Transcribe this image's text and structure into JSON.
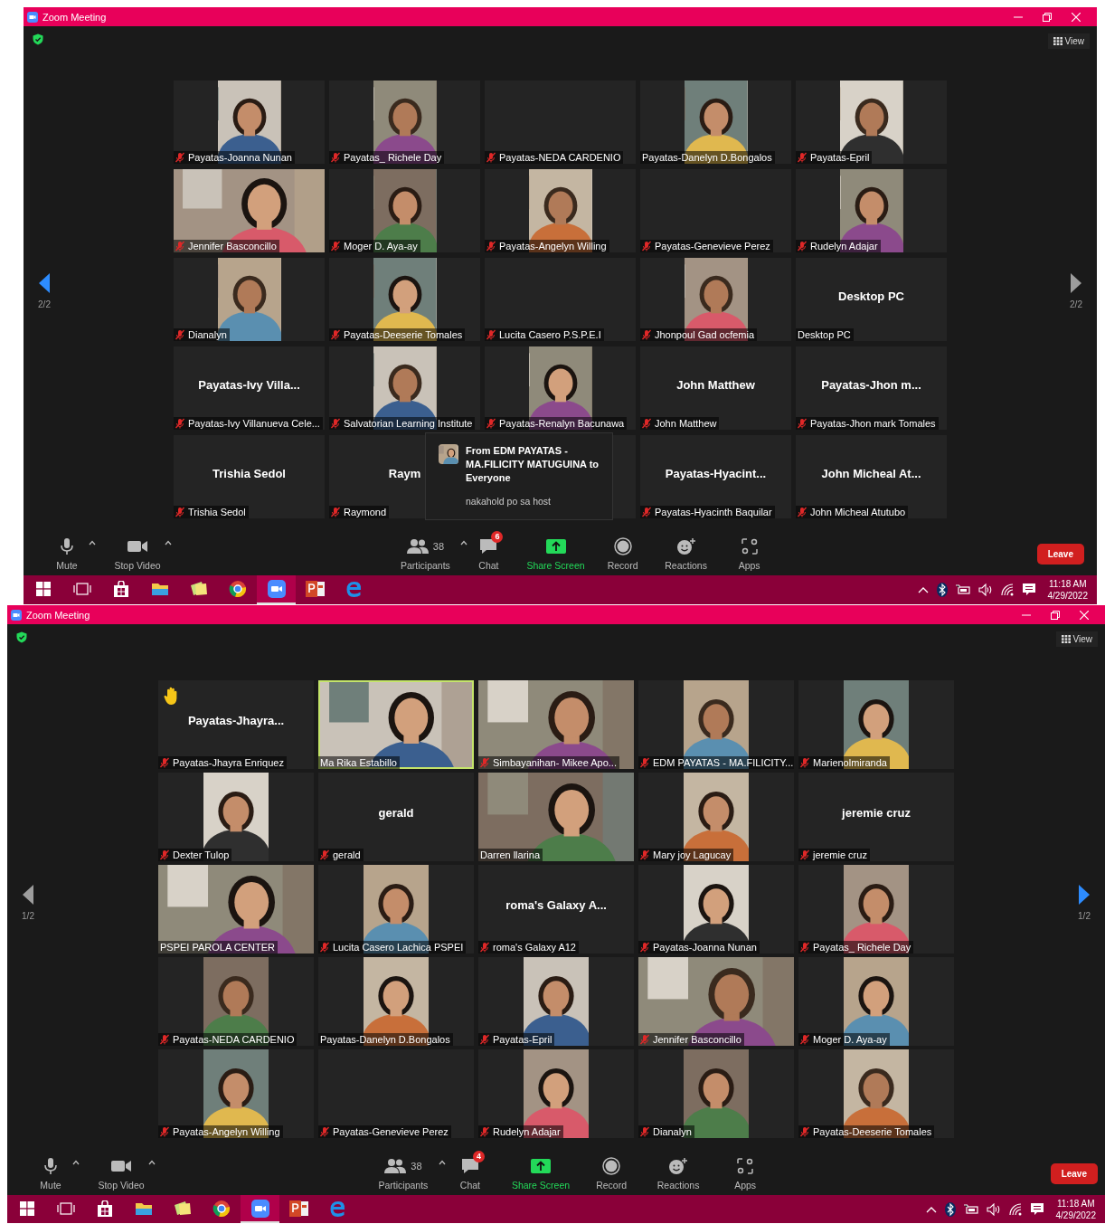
{
  "screens": [
    {
      "window": {
        "title": "Zoom Meeting"
      },
      "view_button": "View",
      "pager": {
        "prev": {
          "label": "2/2",
          "enabled": true
        },
        "next": {
          "label": "2/2",
          "enabled": false
        }
      },
      "tiles": [
        {
          "kind": "video",
          "name": "Payatas-Joanna Nunan",
          "muted": true,
          "speaking": false,
          "hand_raised": false
        },
        {
          "kind": "video",
          "name": "Payatas_ Richele Day",
          "muted": true,
          "speaking": false,
          "hand_raised": false
        },
        {
          "kind": "blank",
          "name": "Payatas-NEDA CARDENIO",
          "muted": true,
          "speaking": false,
          "hand_raised": false
        },
        {
          "kind": "video",
          "name": "Payatas-Danelyn D.Bongalos",
          "muted": false,
          "speaking": false,
          "hand_raised": false
        },
        {
          "kind": "video",
          "name": "Payatas-Epril",
          "muted": true,
          "speaking": false,
          "hand_raised": false
        },
        {
          "kind": "wide",
          "name": "Jennifer Basconcillo",
          "muted": true,
          "speaking": false,
          "hand_raised": false
        },
        {
          "kind": "video",
          "name": "Moger  D. Aya-ay",
          "muted": true,
          "speaking": false,
          "hand_raised": false
        },
        {
          "kind": "video",
          "name": "Payatas-Angelyn Willing",
          "muted": true,
          "speaking": false,
          "hand_raised": false
        },
        {
          "kind": "blank",
          "name": "Payatas-Genevieve Perez",
          "muted": true,
          "speaking": false,
          "hand_raised": false
        },
        {
          "kind": "video",
          "name": "Rudelyn Adajar",
          "muted": true,
          "speaking": false,
          "hand_raised": false
        },
        {
          "kind": "video",
          "name": "Dianalyn",
          "muted": true,
          "speaking": false,
          "hand_raised": false
        },
        {
          "kind": "video",
          "name": "Payatas-Deeserie Tomales",
          "muted": true,
          "speaking": false,
          "hand_raised": false
        },
        {
          "kind": "blank",
          "name": "Lucita Casero P.S.P.E.I",
          "muted": true,
          "speaking": false,
          "hand_raised": false
        },
        {
          "kind": "video",
          "name": "Jhonpoul Gad ocfemia",
          "muted": true,
          "speaking": false,
          "hand_raised": false
        },
        {
          "kind": "name",
          "title": "Desktop PC",
          "name": "Desktop PC",
          "muted": false,
          "speaking": false,
          "hand_raised": false
        },
        {
          "kind": "name",
          "title": "Payatas-Ivy  Villa...",
          "name": "Payatas-Ivy Villanueva Cele...",
          "muted": true,
          "speaking": false,
          "hand_raised": false
        },
        {
          "kind": "video",
          "name": "Salvatorian Learning Institute",
          "muted": true,
          "speaking": false,
          "hand_raised": false
        },
        {
          "kind": "video",
          "name": "Payatas-Renalyn Bacunawa",
          "muted": true,
          "speaking": false,
          "hand_raised": false
        },
        {
          "kind": "name",
          "title": "John Matthew",
          "name": "John Matthew",
          "muted": true,
          "speaking": false,
          "hand_raised": false
        },
        {
          "kind": "name",
          "title": "Payatas-Jhon  m...",
          "name": "Payatas-Jhon mark Tomales",
          "muted": true,
          "speaking": false,
          "hand_raised": false
        },
        {
          "kind": "name",
          "title": "Trishia Sedol",
          "name": "Trishia Sedol",
          "muted": true,
          "speaking": false,
          "hand_raised": false
        },
        {
          "kind": "name",
          "title": "Raym",
          "name": "Raymond",
          "muted": true,
          "speaking": false,
          "hand_raised": false
        },
        {
          "kind": "covered"
        },
        {
          "kind": "name",
          "title": "Payatas-Hyacint...",
          "name": "Payatas-Hyacinth Baquilar",
          "muted": true,
          "speaking": false,
          "hand_raised": false
        },
        {
          "kind": "name",
          "title": "John Micheal  At...",
          "name": "John Micheal Atutubo",
          "muted": true,
          "speaking": false,
          "hand_raised": false
        }
      ],
      "chat_popup": {
        "header": "From EDM PAYATAS - MA.FILICITY MATUGUINA to Everyone",
        "message": "nakahold po sa host"
      },
      "toolbar": [
        {
          "kind": "mute",
          "label": "Mute"
        },
        {
          "kind": "video",
          "label": "Stop Video"
        },
        {
          "kind": "participants",
          "label": "Participants",
          "count": "38"
        },
        {
          "kind": "chat",
          "label": "Chat",
          "badge": "6"
        },
        {
          "kind": "share",
          "label": "Share Screen"
        },
        {
          "kind": "record",
          "label": "Record"
        },
        {
          "kind": "reactions",
          "label": "Reactions"
        },
        {
          "kind": "apps",
          "label": "Apps"
        }
      ],
      "leave_button": "Leave",
      "taskbar": {
        "apps": [
          {
            "kind": "start",
            "active": false
          },
          {
            "kind": "taskview",
            "active": false
          },
          {
            "kind": "store",
            "active": false
          },
          {
            "kind": "explorer",
            "active": false
          },
          {
            "kind": "notes",
            "active": false
          },
          {
            "kind": "chrome",
            "active": false
          },
          {
            "kind": "zoom",
            "active": true
          },
          {
            "kind": "powerpoint",
            "active": false
          },
          {
            "kind": "edge",
            "active": false
          }
        ],
        "time": "11:18 AM",
        "date": "4/29/2022"
      }
    },
    {
      "window": {
        "title": "Zoom Meeting"
      },
      "view_button": "View",
      "pager": {
        "prev": {
          "label": "1/2",
          "enabled": false
        },
        "next": {
          "label": "1/2",
          "enabled": true
        }
      },
      "tiles": [
        {
          "kind": "name",
          "title": "Payatas-Jhayra...",
          "name": "Payatas-Jhayra Enriquez",
          "muted": true,
          "speaking": false,
          "hand_raised": true
        },
        {
          "kind": "wide",
          "name": "Ma Rika Estabillo",
          "muted": false,
          "speaking": true,
          "hand_raised": false
        },
        {
          "kind": "wide",
          "name": "Simbayanihan- Mikee Apo...",
          "muted": true,
          "speaking": false,
          "hand_raised": false
        },
        {
          "kind": "video",
          "name": "EDM PAYATAS - MA.FILICITY...",
          "muted": true,
          "speaking": false,
          "hand_raised": false
        },
        {
          "kind": "video",
          "name": "Marienolmiranda",
          "muted": true,
          "speaking": false,
          "hand_raised": false
        },
        {
          "kind": "video",
          "name": "Dexter Tulop",
          "muted": true,
          "speaking": false,
          "hand_raised": false
        },
        {
          "kind": "name",
          "title": "gerald",
          "name": "gerald",
          "muted": true,
          "speaking": false,
          "hand_raised": false
        },
        {
          "kind": "wide",
          "name": "Darren llarina",
          "muted": false,
          "speaking": false,
          "hand_raised": false
        },
        {
          "kind": "video",
          "name": "Mary joy Lagucay",
          "muted": true,
          "speaking": false,
          "hand_raised": false
        },
        {
          "kind": "name",
          "title": "jeremie cruz",
          "name": "jeremie cruz",
          "muted": true,
          "speaking": false,
          "hand_raised": false
        },
        {
          "kind": "wide",
          "name": "PSPEI PAROLA CENTER",
          "muted": false,
          "speaking": false,
          "hand_raised": false
        },
        {
          "kind": "video",
          "name": "Lucita Casero Lachica PSPEI",
          "muted": true,
          "speaking": false,
          "hand_raised": false
        },
        {
          "kind": "name",
          "title": "roma's Galaxy  A...",
          "name": "roma's Galaxy A12",
          "muted": true,
          "speaking": false,
          "hand_raised": false
        },
        {
          "kind": "video",
          "name": "Payatas-Joanna Nunan",
          "muted": true,
          "speaking": false,
          "hand_raised": false
        },
        {
          "kind": "video",
          "name": "Payatas_ Richele Day",
          "muted": true,
          "speaking": false,
          "hand_raised": false
        },
        {
          "kind": "video",
          "name": "Payatas-NEDA CARDENIO",
          "muted": true,
          "speaking": false,
          "hand_raised": false
        },
        {
          "kind": "video",
          "name": "Payatas-Danelyn D.Bongalos",
          "muted": false,
          "speaking": false,
          "hand_raised": false
        },
        {
          "kind": "video",
          "name": "Payatas-Epril",
          "muted": true,
          "speaking": false,
          "hand_raised": false
        },
        {
          "kind": "wide",
          "name": "Jennifer Basconcillo",
          "muted": true,
          "speaking": false,
          "hand_raised": false
        },
        {
          "kind": "video",
          "name": "Moger  D. Aya-ay",
          "muted": true,
          "speaking": false,
          "hand_raised": false
        },
        {
          "kind": "video",
          "name": "Payatas-Angelyn Willing",
          "muted": true,
          "speaking": false,
          "hand_raised": false
        },
        {
          "kind": "blank",
          "name": "Payatas-Genevieve Perez",
          "muted": true,
          "speaking": false,
          "hand_raised": false
        },
        {
          "kind": "video",
          "name": "Rudelyn Adajar",
          "muted": true,
          "speaking": false,
          "hand_raised": false
        },
        {
          "kind": "video",
          "name": "Dianalyn",
          "muted": true,
          "speaking": false,
          "hand_raised": false
        },
        {
          "kind": "video",
          "name": "Payatas-Deeserie Tomales",
          "muted": true,
          "speaking": false,
          "hand_raised": false
        }
      ],
      "toolbar": [
        {
          "kind": "mute",
          "label": "Mute"
        },
        {
          "kind": "video",
          "label": "Stop Video"
        },
        {
          "kind": "participants",
          "label": "Participants",
          "count": "38"
        },
        {
          "kind": "chat",
          "label": "Chat",
          "badge": "4"
        },
        {
          "kind": "share",
          "label": "Share Screen"
        },
        {
          "kind": "record",
          "label": "Record"
        },
        {
          "kind": "reactions",
          "label": "Reactions"
        },
        {
          "kind": "apps",
          "label": "Apps"
        }
      ],
      "leave_button": "Leave",
      "taskbar": {
        "apps": [
          {
            "kind": "start",
            "active": false
          },
          {
            "kind": "taskview",
            "active": false
          },
          {
            "kind": "store",
            "active": false
          },
          {
            "kind": "explorer",
            "active": false
          },
          {
            "kind": "notes",
            "active": false
          },
          {
            "kind": "chrome",
            "active": false
          },
          {
            "kind": "zoom",
            "active": true
          },
          {
            "kind": "powerpoint",
            "active": false
          },
          {
            "kind": "edge",
            "active": false
          }
        ],
        "time": "11:18 AM",
        "date": "4/29/2022"
      }
    }
  ]
}
